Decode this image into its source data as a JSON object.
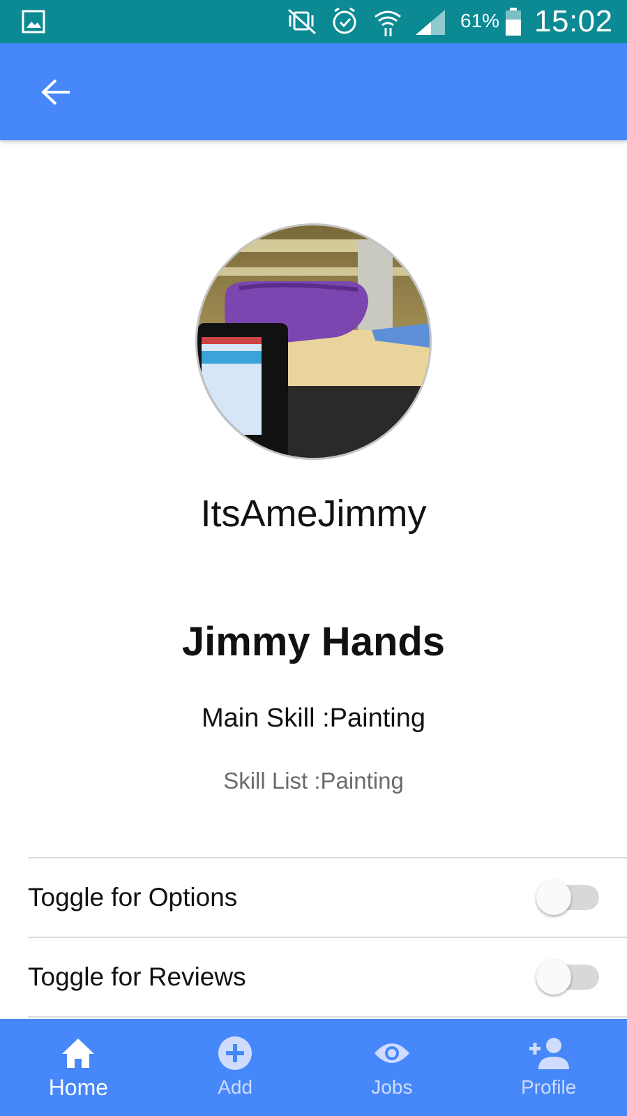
{
  "status_bar": {
    "battery_percent": "61%",
    "time": "15:02",
    "icons": [
      "gallery-icon",
      "vibrate-icon",
      "alarm-icon",
      "wifi-icon",
      "signal-icon",
      "battery-icon"
    ]
  },
  "app_bar": {
    "back_icon": "arrow-left-icon"
  },
  "profile": {
    "username": "ItsAmeJimmy",
    "full_name": "Jimmy Hands",
    "main_skill": "Main Skill :Painting",
    "skill_list": "Skill List :Painting"
  },
  "toggles": [
    {
      "label": "Toggle for Options",
      "on": false
    },
    {
      "label": "Toggle for Reviews",
      "on": false
    }
  ],
  "bottom_nav": {
    "items": [
      {
        "label": "Home",
        "icon": "home-icon",
        "active": true
      },
      {
        "label": "Add",
        "icon": "add-circle-icon",
        "active": false
      },
      {
        "label": "Jobs",
        "icon": "eye-icon",
        "active": false
      },
      {
        "label": "Profile",
        "icon": "person-add-icon",
        "active": false
      }
    ]
  },
  "colors": {
    "status_bar": "#0b8a93",
    "primary": "#4687f9",
    "inactive_nav": "#cfdcfd"
  }
}
